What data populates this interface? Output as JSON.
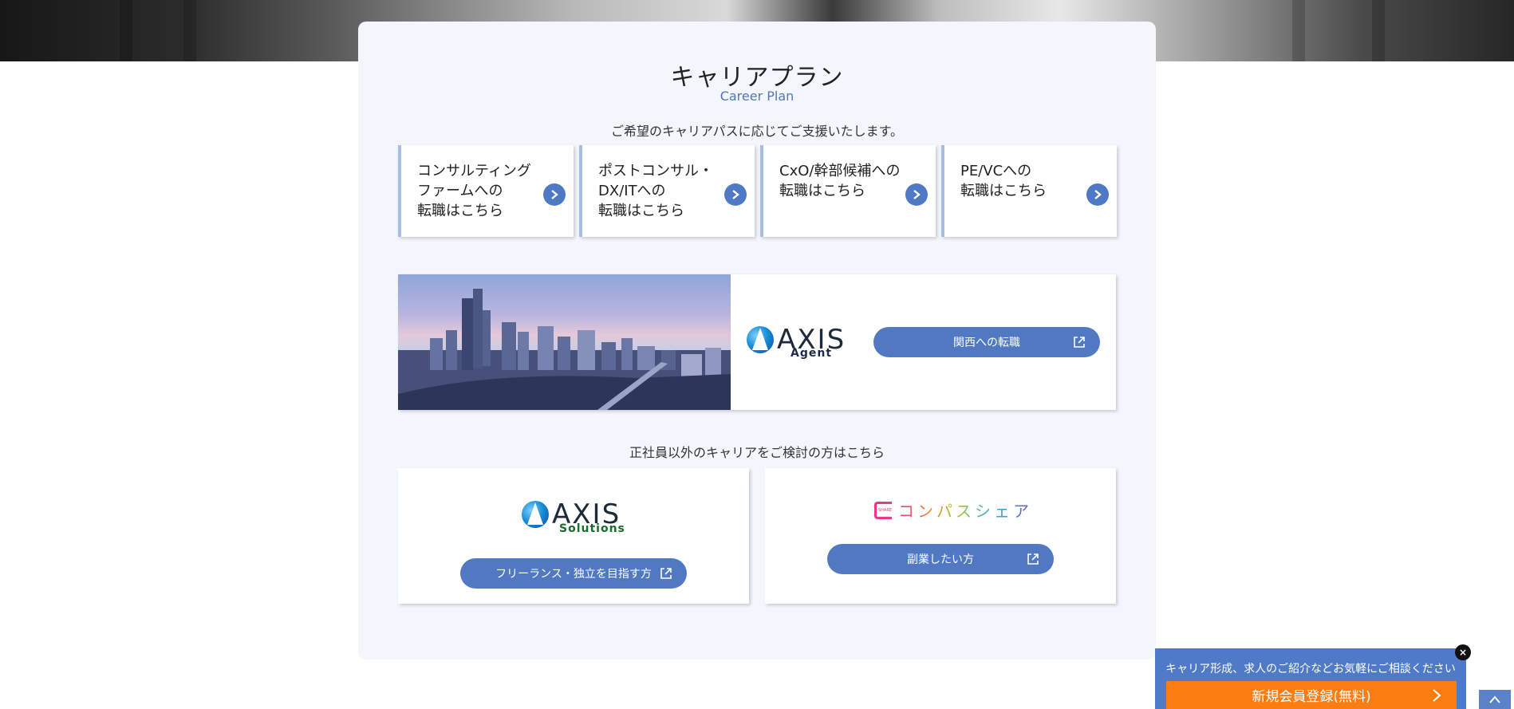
{
  "section": {
    "title": "キャリアプラン",
    "subtitle": "Career Plan",
    "lead": "ご希望のキャリアパスに応じてご支援いたします。"
  },
  "career_cards": [
    {
      "lines": [
        "コンサルティング",
        "ファームへの",
        "転職はこちら"
      ]
    },
    {
      "lines": [
        "ポストコンサル・",
        "DX/ITへの",
        "転職はこちら"
      ]
    },
    {
      "lines": [
        "CxO/幹部候補への",
        "転職はこちら"
      ]
    },
    {
      "lines": [
        "PE/VCへの",
        "転職はこちら"
      ]
    }
  ],
  "agent_banner": {
    "logo_word": "AXIS",
    "logo_sub": "Agent",
    "button_label": "関西への転職"
  },
  "non_fulltime": {
    "label": "正社員以外のキャリアをご検討の方はこちら",
    "solutions": {
      "logo_word": "AXIS",
      "logo_sub": "Solutions",
      "button_label": "フリーランス・独立を目指す方"
    },
    "compass": {
      "logo_icon_text": "SHARE",
      "logo_text": "コンパスシェア",
      "button_label": "副業したい方"
    }
  },
  "cta": {
    "message": "キャリア形成、求人のご紹介などお気軽にご相談ください",
    "register_label": "新規会員登録(無料)",
    "close_symbol": "×"
  },
  "colors": {
    "accent": "#4f79c4",
    "panel_bg": "#f3f7fd",
    "register_orange": "#fb7d12",
    "subtitle_blue": "#5577b3"
  },
  "icons": {
    "card_arrow": "chevron-right-icon",
    "external_link": "external-link-icon",
    "scroll_top": "chevron-up-icon",
    "close": "close-icon"
  }
}
